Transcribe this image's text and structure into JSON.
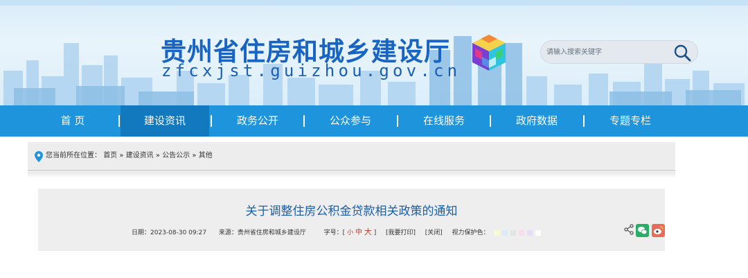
{
  "header": {
    "site_title": "贵州省住房和城乡建设厅",
    "site_domain": "zfcxjst.guizhou.gov.cn",
    "search_placeholder": "请输入搜索关键字"
  },
  "nav": {
    "items": [
      {
        "label": "首  页",
        "active": false
      },
      {
        "label": "建设资讯",
        "active": true
      },
      {
        "label": "政务公开",
        "active": false
      },
      {
        "label": "公众参与",
        "active": false
      },
      {
        "label": "在线服务",
        "active": false
      },
      {
        "label": "政府数据",
        "active": false
      },
      {
        "label": "专题专栏",
        "active": false
      }
    ]
  },
  "breadcrumb": {
    "prefix": "您当前所在位置：",
    "items": [
      "首页",
      "建设资讯",
      "公告公示",
      "其他"
    ],
    "separator": "»"
  },
  "article": {
    "title": "关于调整住房公积金贷款相关政策的通知",
    "date_label": "日期：",
    "date": "2023-08-30 09:27",
    "source_label": "来源：",
    "source": "贵州省住房和城乡建设厅",
    "font_size_label": "字号：",
    "bracket_open": "[",
    "bracket_close": "]",
    "font_small": "小",
    "font_medium": "中",
    "font_large": "大",
    "print_link": "[我要打印]",
    "close_link": "[关闭]",
    "eye_care_label": "视力保护色：",
    "eye_care_colors": [
      "#fafad2",
      "#d8ecf8",
      "#e4e4e4",
      "#f6dfe8",
      "#e6def4",
      "#ffffff"
    ]
  },
  "colors": {
    "nav_bg": "#1e94dc",
    "nav_active": "#1379bf",
    "title_blue": "#1864c4",
    "article_title": "#1a5fa8"
  }
}
